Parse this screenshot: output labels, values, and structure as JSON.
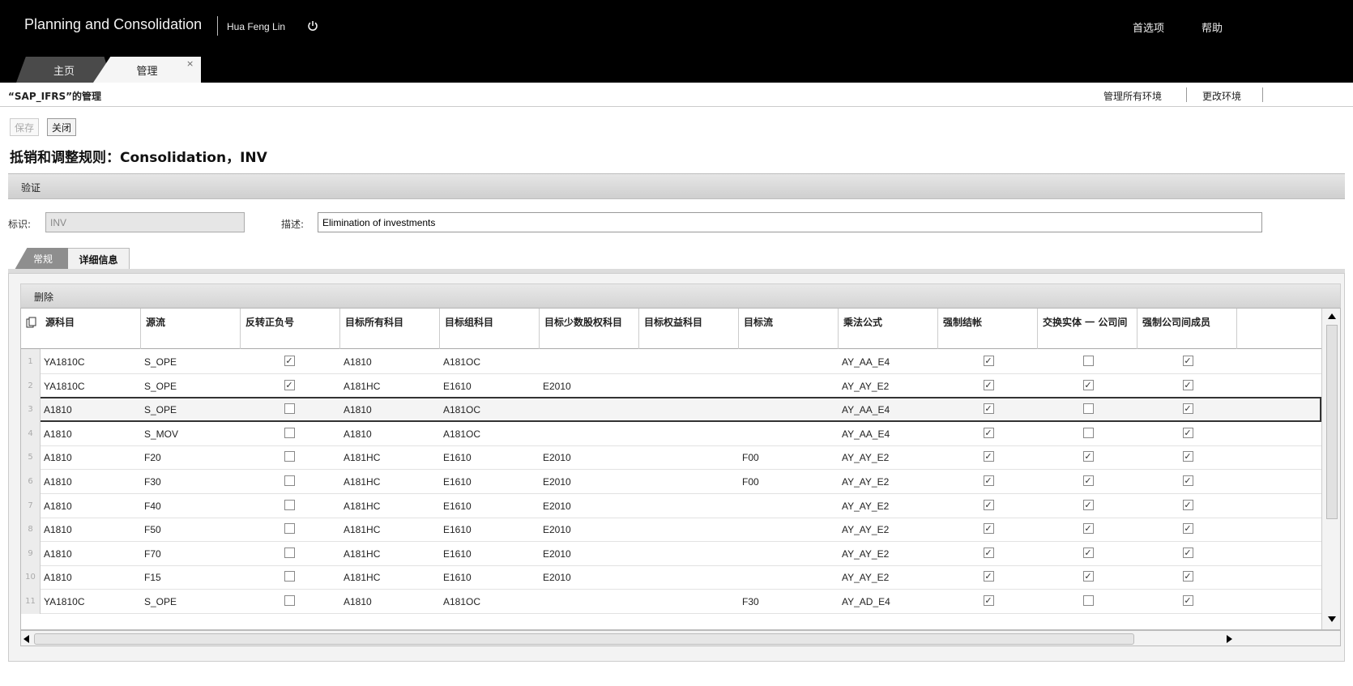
{
  "header": {
    "app_title": "Planning and Consolidation",
    "user_name": "Hua Feng Lin",
    "preferences": "首选项",
    "help": "帮助",
    "tabs": [
      {
        "label": "主页"
      },
      {
        "label": "管理"
      }
    ],
    "tab_close": "×"
  },
  "subheader": {
    "env_title": "“SAP_IFRS”的管理",
    "manage_all_env": "管理所有环境",
    "change_env": "更改环境"
  },
  "toolbar": {
    "save": "保存",
    "close": "关闭"
  },
  "page_title": "抵销和调整规则：Consolidation，INV",
  "validate_label": "验证",
  "form": {
    "id_label": "标识:",
    "id_value": "INV",
    "desc_label": "描述:",
    "desc_value": "Elimination of investments"
  },
  "subtabs": {
    "general": "常规",
    "detail": "详细信息"
  },
  "grid": {
    "delete_label": "删除",
    "columns": [
      "源科目",
      "源流",
      "反转正负号",
      "目标所有科目",
      "目标组科目",
      "目标少数股权科目",
      "目标权益科目",
      "目标流",
      "乘法公式",
      "强制结帐",
      "交换实体 一 公司间",
      "强制公司间成员"
    ],
    "rows": [
      {
        "num": "1",
        "src_account": "YA1810C",
        "src_flow": "S_OPE",
        "reverse_sign": true,
        "target_all": "A1810",
        "target_group": "A181OC",
        "target_minority": "",
        "target_equity": "",
        "target_flow": "",
        "formula": "AY_AA_E4",
        "force_close": true,
        "swap_entity": false,
        "force_ic": true
      },
      {
        "num": "2",
        "src_account": "YA1810C",
        "src_flow": "S_OPE",
        "reverse_sign": true,
        "target_all": "A181HC",
        "target_group": "E1610",
        "target_minority": "E2010",
        "target_equity": "",
        "target_flow": "",
        "formula": "AY_AY_E2",
        "force_close": true,
        "swap_entity": true,
        "force_ic": true
      },
      {
        "num": "3",
        "src_account": "A1810",
        "src_flow": "S_OPE",
        "reverse_sign": false,
        "target_all": "A1810",
        "target_group": "A181OC",
        "target_minority": "",
        "target_equity": "",
        "target_flow": "",
        "formula": "AY_AA_E4",
        "force_close": true,
        "swap_entity": false,
        "force_ic": true
      },
      {
        "num": "4",
        "src_account": "A1810",
        "src_flow": "S_MOV",
        "reverse_sign": false,
        "target_all": "A1810",
        "target_group": "A181OC",
        "target_minority": "",
        "target_equity": "",
        "target_flow": "",
        "formula": "AY_AA_E4",
        "force_close": true,
        "swap_entity": false,
        "force_ic": true
      },
      {
        "num": "5",
        "src_account": "A1810",
        "src_flow": "F20",
        "reverse_sign": false,
        "target_all": "A181HC",
        "target_group": "E1610",
        "target_minority": "E2010",
        "target_equity": "",
        "target_flow": "F00",
        "formula": "AY_AY_E2",
        "force_close": true,
        "swap_entity": true,
        "force_ic": true
      },
      {
        "num": "6",
        "src_account": "A1810",
        "src_flow": "F30",
        "reverse_sign": false,
        "target_all": "A181HC",
        "target_group": "E1610",
        "target_minority": "E2010",
        "target_equity": "",
        "target_flow": "F00",
        "formula": "AY_AY_E2",
        "force_close": true,
        "swap_entity": true,
        "force_ic": true
      },
      {
        "num": "7",
        "src_account": "A1810",
        "src_flow": "F40",
        "reverse_sign": false,
        "target_all": "A181HC",
        "target_group": "E1610",
        "target_minority": "E2010",
        "target_equity": "",
        "target_flow": "",
        "formula": "AY_AY_E2",
        "force_close": true,
        "swap_entity": true,
        "force_ic": true
      },
      {
        "num": "8",
        "src_account": "A1810",
        "src_flow": "F50",
        "reverse_sign": false,
        "target_all": "A181HC",
        "target_group": "E1610",
        "target_minority": "E2010",
        "target_equity": "",
        "target_flow": "",
        "formula": "AY_AY_E2",
        "force_close": true,
        "swap_entity": true,
        "force_ic": true
      },
      {
        "num": "9",
        "src_account": "A1810",
        "src_flow": "F70",
        "reverse_sign": false,
        "target_all": "A181HC",
        "target_group": "E1610",
        "target_minority": "E2010",
        "target_equity": "",
        "target_flow": "",
        "formula": "AY_AY_E2",
        "force_close": true,
        "swap_entity": true,
        "force_ic": true
      },
      {
        "num": "10",
        "src_account": "A1810",
        "src_flow": "F15",
        "reverse_sign": false,
        "target_all": "A181HC",
        "target_group": "E1610",
        "target_minority": "E2010",
        "target_equity": "",
        "target_flow": "",
        "formula": "AY_AY_E2",
        "force_close": true,
        "swap_entity": true,
        "force_ic": true
      },
      {
        "num": "11",
        "src_account": "YA1810C",
        "src_flow": "S_OPE",
        "reverse_sign": false,
        "target_all": "A1810",
        "target_group": "A181OC",
        "target_minority": "",
        "target_equity": "",
        "target_flow": "F30",
        "formula": "AY_AD_E4",
        "force_close": true,
        "swap_entity": false,
        "force_ic": true
      }
    ]
  },
  "icons": {
    "power": "power-icon",
    "copy": "copy-icon",
    "checkmark": "✓"
  },
  "colors": {
    "header_bg": "#000000",
    "panel_bg": "#f3f3f3",
    "selected_row_border": "#333333"
  }
}
